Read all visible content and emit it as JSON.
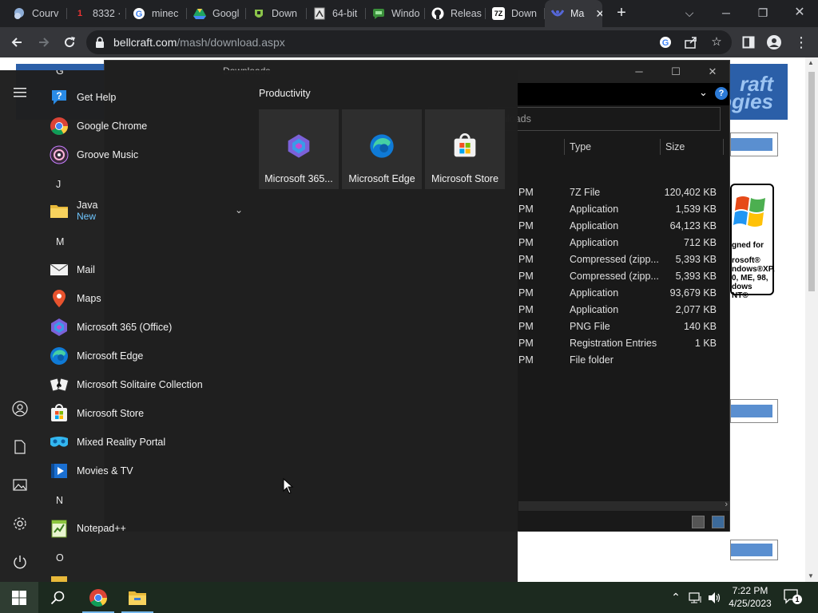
{
  "browser": {
    "tabs": [
      {
        "title": "Courv",
        "favicon": "courvix-icon",
        "color": "#9fb7d9",
        "active": false
      },
      {
        "title": "8332 ·",
        "favicon": "page-icon",
        "color": "#e33",
        "active": false
      },
      {
        "title": "minec",
        "favicon": "google-icon",
        "color": "#fff",
        "active": false
      },
      {
        "title": "Googl",
        "favicon": "google-drive-icon",
        "color": "#1fa463",
        "active": false
      },
      {
        "title": "Down",
        "favicon": "download-site-icon",
        "color": "#8bc34a",
        "active": false
      },
      {
        "title": "64-bit",
        "favicon": "document-icon",
        "color": "#ddd",
        "active": false
      },
      {
        "title": "Windo",
        "favicon": "chat-icon",
        "color": "#3a8f3a",
        "active": false
      },
      {
        "title": "Releas",
        "favicon": "github-icon",
        "color": "#fff",
        "active": false
      },
      {
        "title": "Down",
        "favicon": "7zip-icon",
        "color": "#fff",
        "active": false
      },
      {
        "title": "Ma",
        "favicon": "mash-icon",
        "color": "#33a",
        "active": true
      }
    ],
    "close_glyph": "✕",
    "new_tab_glyph": "+",
    "url_domain": "bellcraft.com",
    "url_path": "/mash/download.aspx"
  },
  "page": {
    "logo_line1": "raft",
    "logo_line2": "ogies",
    "xp_badge_top": "gned for",
    "xp_badge_lines": [
      "rosoft®",
      "ndows®XP,",
      "0, ME, 98,",
      "dows NT®"
    ]
  },
  "explorer": {
    "title": "Downloads",
    "search_placeholder": "ownloads",
    "columns": {
      "type": "Type",
      "size": "Size"
    },
    "rows": [
      {
        "time": "PM",
        "type": "7Z File",
        "size": "120,402 KB"
      },
      {
        "time": "PM",
        "type": "Application",
        "size": "1,539 KB"
      },
      {
        "time": "PM",
        "type": "Application",
        "size": "64,123 KB"
      },
      {
        "time": "PM",
        "type": "Application",
        "size": "712 KB"
      },
      {
        "time": "PM",
        "type": "Compressed (zipp...",
        "size": "5,393 KB"
      },
      {
        "time": "PM",
        "type": "Compressed (zipp...",
        "size": "5,393 KB"
      },
      {
        "time": "PM",
        "type": "Application",
        "size": "93,679 KB"
      },
      {
        "time": "PM",
        "type": "Application",
        "size": "2,077 KB"
      },
      {
        "time": "PM",
        "type": "PNG File",
        "size": "140 KB"
      },
      {
        "time": "PM",
        "type": "Registration Entries",
        "size": "1 KB"
      },
      {
        "time": "PM",
        "type": "File folder",
        "size": ""
      }
    ],
    "help_glyph": "?"
  },
  "start_menu": {
    "partial_letter": "G",
    "apps": [
      {
        "name": "Get Help",
        "icon": "get-help-icon"
      },
      {
        "name": "Google Chrome",
        "icon": "chrome-icon"
      },
      {
        "name": "Groove Music",
        "icon": "groove-music-icon"
      },
      {
        "name": "Java",
        "sub": "New",
        "icon": "folder-icon"
      },
      {
        "name": "Mail",
        "icon": "mail-icon"
      },
      {
        "name": "Maps",
        "icon": "maps-icon"
      },
      {
        "name": "Microsoft 365 (Office)",
        "icon": "office-icon"
      },
      {
        "name": "Microsoft Edge",
        "icon": "edge-icon"
      },
      {
        "name": "Microsoft Solitaire Collection",
        "icon": "solitaire-icon"
      },
      {
        "name": "Microsoft Store",
        "icon": "store-icon"
      },
      {
        "name": "Mixed Reality Portal",
        "icon": "mixed-reality-icon"
      },
      {
        "name": "Movies & TV",
        "icon": "movies-tv-icon"
      },
      {
        "name": "Notepad++",
        "icon": "notepad-plus-plus-icon"
      }
    ],
    "letters": {
      "j": "J",
      "m": "M",
      "n": "N",
      "o": "O"
    },
    "group_title": "Productivity",
    "tiles": [
      {
        "label": "Microsoft 365...",
        "icon": "office-icon"
      },
      {
        "label": "Microsoft Edge",
        "icon": "edge-icon"
      },
      {
        "label": "Microsoft Store",
        "icon": "store-icon"
      }
    ]
  },
  "taskbar": {
    "time": "7:22 PM",
    "date": "4/25/2023",
    "notification_count": "1"
  }
}
